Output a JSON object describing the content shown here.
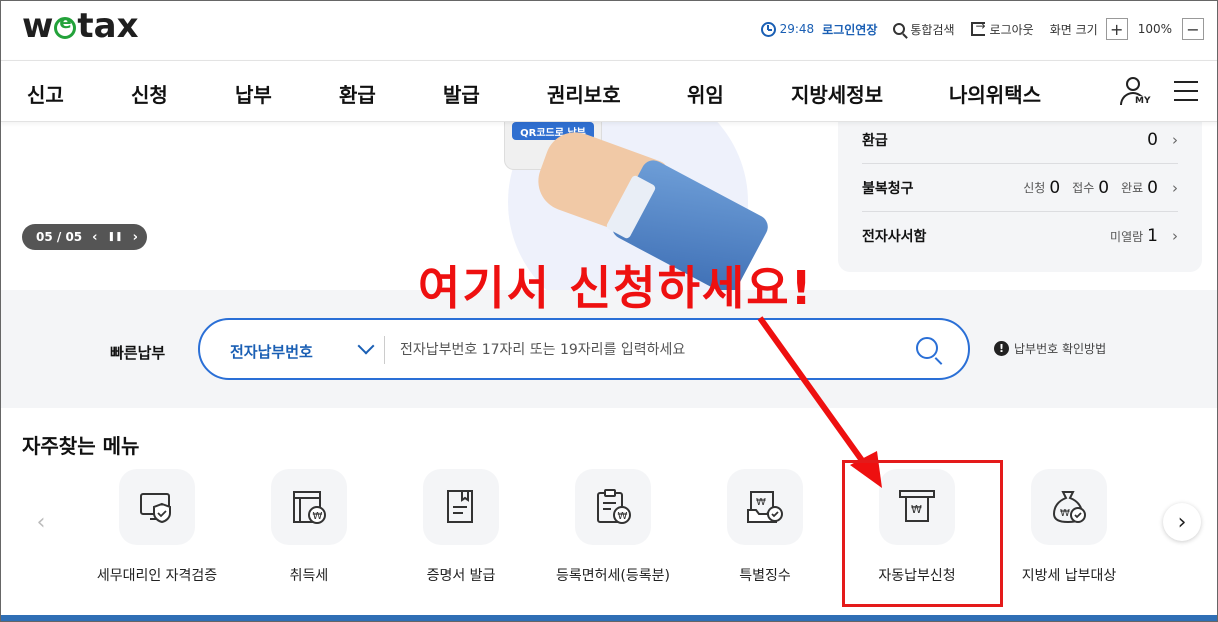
{
  "header": {
    "logo_prefix": "w",
    "logo_suffix": "tax",
    "timer": "29:48",
    "extend_label": "로그인연장",
    "search_label": "통합검색",
    "logout_label": "로그아웃",
    "zoom_label": "화면 크기",
    "zoom_in": "+",
    "zoom_value": "100%",
    "zoom_out": "−"
  },
  "nav": {
    "items": [
      "신고",
      "신청",
      "납부",
      "환급",
      "발급",
      "권리보호",
      "위임",
      "지방세정보",
      "나의위택스"
    ],
    "my_badge": "MY"
  },
  "hero": {
    "qr_button": "QR코드로 납부",
    "slide_counter": "05 / 05",
    "prev": "‹",
    "pause": "❚❚",
    "next": "›"
  },
  "status": {
    "rows": [
      {
        "label": "환급",
        "value": "0"
      },
      {
        "label": "불복청구",
        "sub1": "신청",
        "v1": "0",
        "sub2": "접수",
        "v2": "0",
        "sub3": "완료",
        "v3": "0"
      },
      {
        "label": "전자사서함",
        "sub": "미열람",
        "value": "1"
      }
    ]
  },
  "quickpay": {
    "label": "빠른납부",
    "select_value": "전자납부번호",
    "placeholder": "전자납부번호 17자리 또는 19자리를 입력하세요",
    "help": "납부번호 확인방법"
  },
  "freq": {
    "title": "자주찾는 메뉴",
    "items": [
      {
        "label": "세무대리인 자격검증",
        "icon": "monitor-shield-icon"
      },
      {
        "label": "취득세",
        "icon": "building-won-icon"
      },
      {
        "label": "증명서 발급",
        "icon": "document-icon"
      },
      {
        "label": "등록면허세(등록분)",
        "icon": "clipboard-won-icon"
      },
      {
        "label": "특별징수",
        "icon": "box-check-icon"
      },
      {
        "label": "자동납부신청",
        "icon": "receipt-atm-icon"
      },
      {
        "label": "지방세 납부대상",
        "icon": "money-bag-check-icon"
      }
    ],
    "prev": "‹",
    "next": "›"
  },
  "annotation": {
    "text": "여기서 신청하세요!"
  },
  "colors": {
    "brand_blue": "#2a6fd6",
    "annotation_red": "#ee1010",
    "logo_green": "#23a23a"
  }
}
